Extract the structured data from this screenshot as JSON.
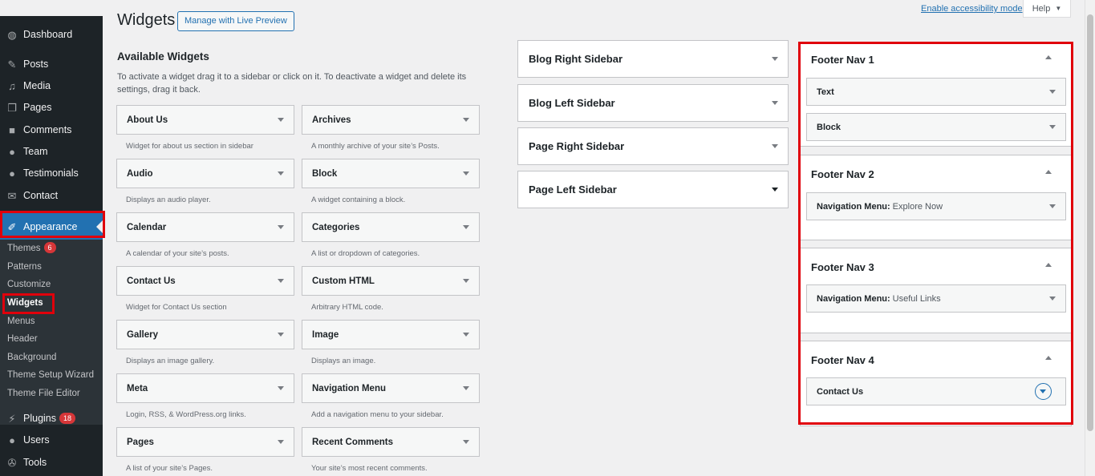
{
  "sidebar": {
    "items": [
      {
        "label": "Dashboard",
        "icon": "dashboard-icon"
      },
      {
        "label": "Posts",
        "icon": "pin-icon"
      },
      {
        "label": "Media",
        "icon": "media-icon"
      },
      {
        "label": "Pages",
        "icon": "pages-icon"
      },
      {
        "label": "Comments",
        "icon": "comment-icon"
      },
      {
        "label": "Team",
        "icon": "user-icon"
      },
      {
        "label": "Testimonials",
        "icon": "user-icon"
      },
      {
        "label": "Contact",
        "icon": "envelope-icon"
      },
      {
        "label": "Appearance",
        "icon": "brush-icon"
      },
      {
        "label": "Plugins",
        "icon": "plug-icon",
        "badge": "18"
      },
      {
        "label": "Users",
        "icon": "user-icon"
      },
      {
        "label": "Tools",
        "icon": "wrench-icon"
      }
    ],
    "submenu": [
      {
        "label": "Themes",
        "badge": "6"
      },
      {
        "label": "Patterns"
      },
      {
        "label": "Customize"
      },
      {
        "label": "Widgets"
      },
      {
        "label": "Menus"
      },
      {
        "label": "Header"
      },
      {
        "label": "Background"
      },
      {
        "label": "Theme Setup Wizard"
      },
      {
        "label": "Theme File Editor"
      }
    ]
  },
  "header": {
    "title": "Widgets",
    "live_preview": "Manage with Live Preview",
    "accessibility_link": "Enable accessibility mode",
    "help": "Help"
  },
  "available": {
    "title": "Available Widgets",
    "description": "To activate a widget drag it to a sidebar or click on it. To deactivate a widget and delete its settings, drag it back.",
    "widgets": [
      {
        "name": "About Us",
        "desc": "Widget for about us section in sidebar"
      },
      {
        "name": "Archives",
        "desc": "A monthly archive of your site’s Posts."
      },
      {
        "name": "Audio",
        "desc": "Displays an audio player."
      },
      {
        "name": "Block",
        "desc": "A widget containing a block."
      },
      {
        "name": "Calendar",
        "desc": "A calendar of your site’s posts."
      },
      {
        "name": "Categories",
        "desc": "A list or dropdown of categories."
      },
      {
        "name": "Contact Us",
        "desc": "Widget for Contact Us section"
      },
      {
        "name": "Custom HTML",
        "desc": "Arbitrary HTML code."
      },
      {
        "name": "Gallery",
        "desc": "Displays an image gallery."
      },
      {
        "name": "Image",
        "desc": "Displays an image."
      },
      {
        "name": "Meta",
        "desc": "Login, RSS, & WordPress.org links."
      },
      {
        "name": "Navigation Menu",
        "desc": "Add a navigation menu to your sidebar."
      },
      {
        "name": "Pages",
        "desc": "A list of your site’s Pages."
      },
      {
        "name": "Recent Comments",
        "desc": "Your site’s most recent comments."
      }
    ]
  },
  "sidebars": [
    "Blog Right Sidebar",
    "Blog Left Sidebar",
    "Page Right Sidebar",
    "Page Left Sidebar"
  ],
  "footer_navs": [
    {
      "title": "Footer Nav 1",
      "widgets": [
        {
          "name": "Text",
          "sub": ""
        },
        {
          "name": "Block",
          "sub": ""
        }
      ]
    },
    {
      "title": "Footer Nav 2",
      "widgets": [
        {
          "name": "Navigation Menu:",
          "sub": "Explore Now"
        }
      ]
    },
    {
      "title": "Footer Nav 3",
      "widgets": [
        {
          "name": "Navigation Menu:",
          "sub": "Useful Links"
        }
      ]
    },
    {
      "title": "Footer Nav 4",
      "widgets": [
        {
          "name": "Contact Us",
          "sub": ""
        }
      ]
    }
  ],
  "colors": {
    "highlight": "#e0000b",
    "accent": "#2271b1",
    "sidebar_bg": "#1d2327"
  }
}
